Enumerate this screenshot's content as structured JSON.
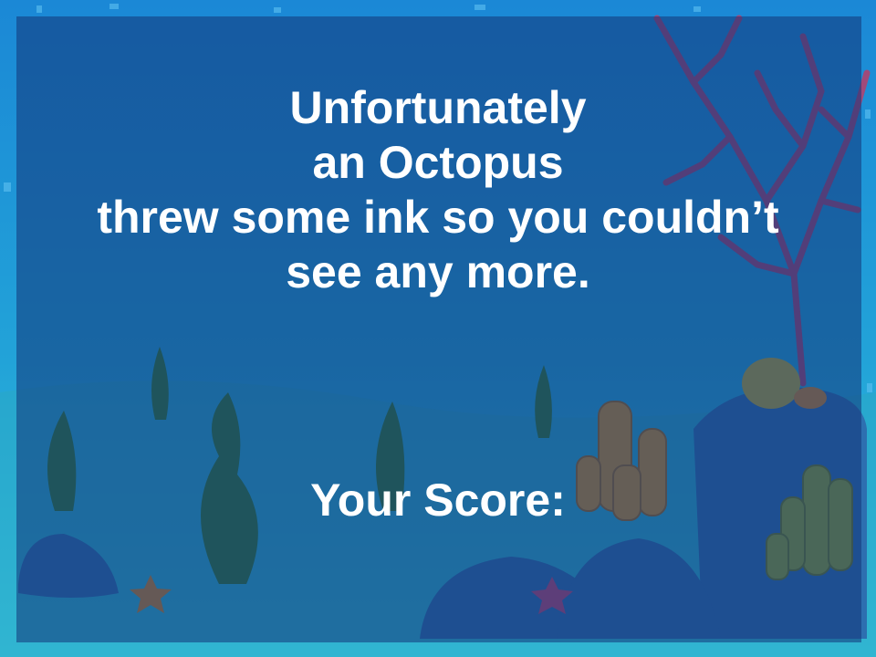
{
  "game": {
    "message_lines": [
      "Unfortunately",
      "an Octopus",
      "threw some ink so you couldn’t",
      "see any more."
    ],
    "score_label": "Your Score:",
    "score_value": ""
  },
  "colors": {
    "frame": "#2a9fe0",
    "overlay": "#123478",
    "text": "#ffffff",
    "coral": "#a04a7a",
    "sponge": "#c9912e",
    "seaweed": "#2f7a3a"
  }
}
